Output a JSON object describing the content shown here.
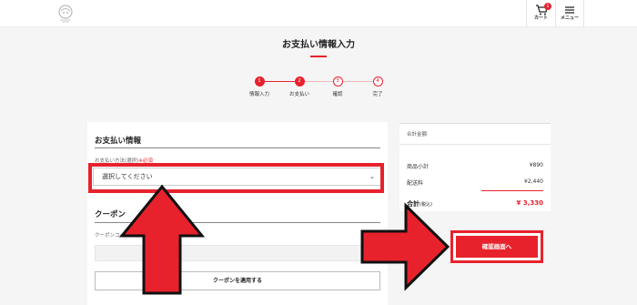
{
  "header": {
    "cart_label": "カート",
    "cart_count": "1",
    "menu_label": "メニュー"
  },
  "page": {
    "title": "お支払い情報入力"
  },
  "steps": [
    {
      "num": "1",
      "label": "情報入力",
      "state": "done"
    },
    {
      "num": "2",
      "label": "お支払い",
      "state": "done"
    },
    {
      "num": "3",
      "label": "確認",
      "state": "todo"
    },
    {
      "num": "4",
      "label": "完了",
      "state": "todo"
    }
  ],
  "payment": {
    "section_title": "お支払い情報",
    "method_label": "お支払い方法(選択)",
    "required_mark": "※必須",
    "select_value": "選択してください"
  },
  "coupon": {
    "section_title": "クーポン",
    "code_label": "クーポンコード",
    "code_value": "",
    "apply_label": "クーポンを適用する"
  },
  "summary": {
    "heading": "合計金額",
    "subtotal_label": "商品小計",
    "subtotal_value": "¥890",
    "shipping_label": "配送料",
    "shipping_value": "¥2,440",
    "total_label": "合計",
    "total_tax": "(税込)",
    "total_value": "¥ 3,330",
    "confirm_label": "確認画面へ"
  },
  "colors": {
    "accent": "#e7222c",
    "arrow_outline": "#111111"
  }
}
